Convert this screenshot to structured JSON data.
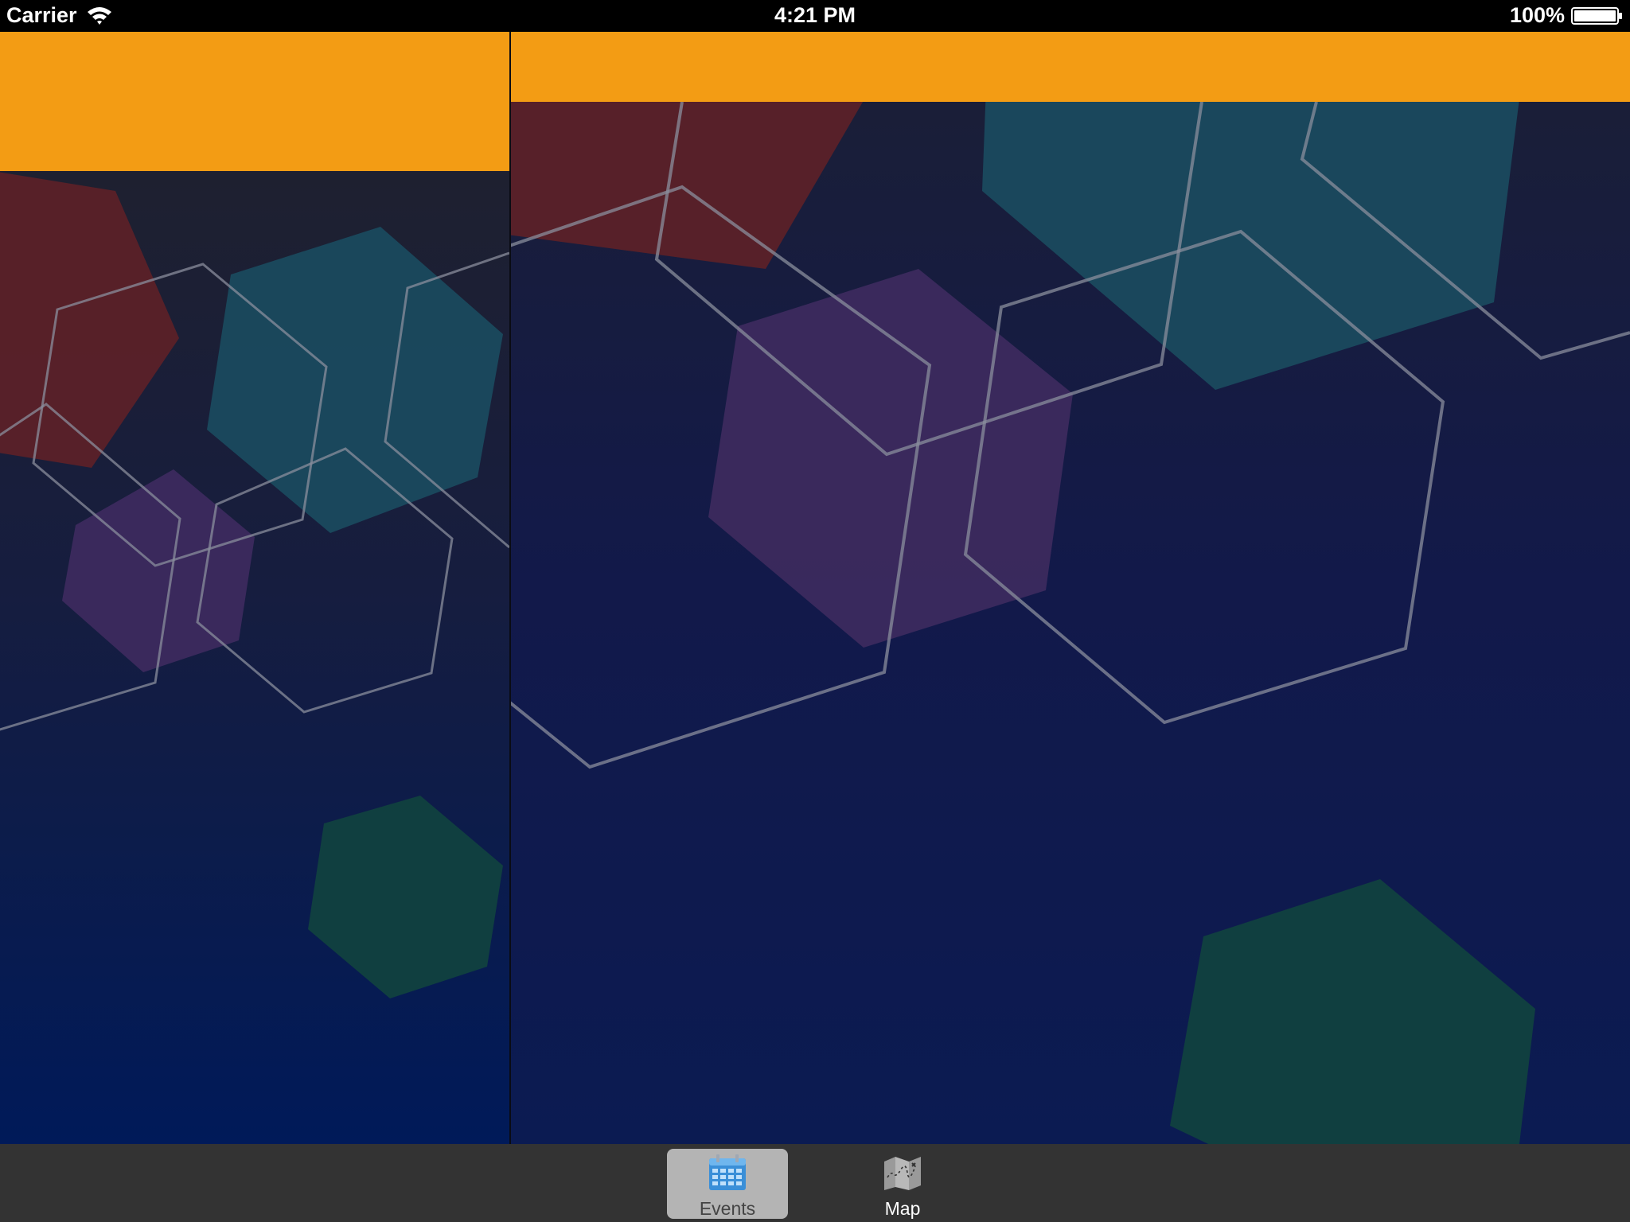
{
  "status_bar": {
    "carrier": "Carrier",
    "time": "4:21 PM",
    "battery": "100%",
    "wifi_icon": "wifi-icon",
    "battery_icon": "battery-icon"
  },
  "colors": {
    "nav_bar": "#f39c14",
    "tab_bar": "#333333",
    "selected_tab": "#b4b4b4",
    "background_top": "#21212b",
    "background_bottom": "#001a59",
    "hex_red": "#5b2128",
    "hex_teal": "#1a4a5e",
    "hex_purple": "#3c2a5e",
    "hex_green": "#11413f"
  },
  "tab_bar": {
    "tabs": [
      {
        "label": "Events",
        "icon": "calendar-icon",
        "selected": true
      },
      {
        "label": "Map",
        "icon": "map-icon",
        "selected": false
      }
    ]
  }
}
